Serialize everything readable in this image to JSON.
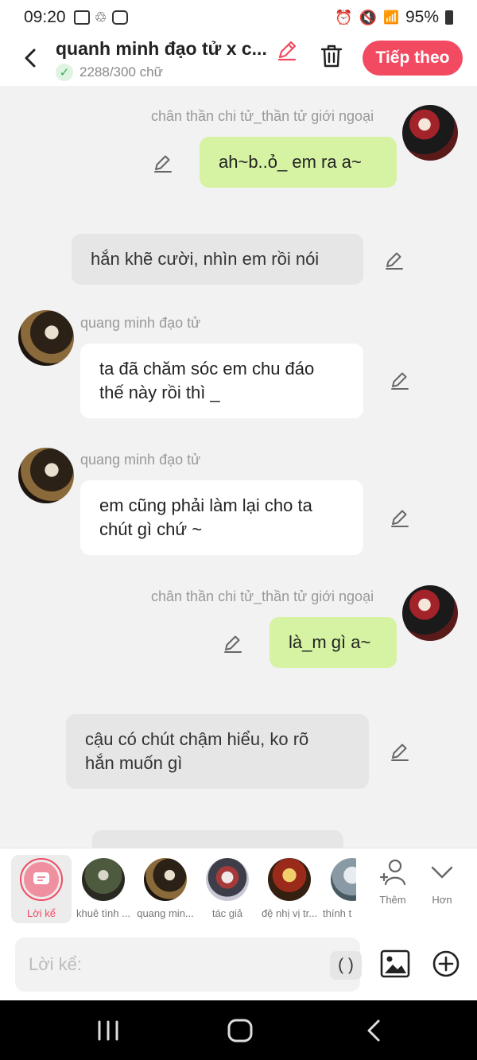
{
  "status": {
    "time": "09:20",
    "battery": "95%"
  },
  "header": {
    "title": "quanh minh đạo tử x c...",
    "word_count": "2288/300 chữ",
    "next_label": "Tiếp theo",
    "accent_color": "#f24a61"
  },
  "messages": [
    {
      "type": "user",
      "name": "chân thần chi tử_thần tử giới ngoại",
      "text": "ah~b..ỏ_ em ra a~"
    },
    {
      "type": "narration",
      "text": "hắn khẽ cười, nhìn em rồi nói"
    },
    {
      "type": "character",
      "name": "quang minh đạo tử",
      "lines": [
        "ta đã chăm sóc em chu đáo",
        "thế này rồi thì _"
      ]
    },
    {
      "type": "character",
      "name": "quang minh đạo tử",
      "lines": [
        "em cũng phải làm lại cho ta",
        "chút gì chứ ~"
      ]
    },
    {
      "type": "user",
      "name": "chân thần chi tử_thần tử giới ngoại",
      "text": "là_m gì a~"
    },
    {
      "type": "narration",
      "lines": [
        "cậu có chút chậm hiểu, ko rõ",
        "hắn muốn gì"
      ]
    }
  ],
  "characters": {
    "narrator": "Lời kể",
    "items": [
      "khuê tình ...",
      "quang min...",
      "tác giả",
      "đệ nhị vị tr...",
      "thính t"
    ],
    "add_label": "Thêm",
    "more_label": "Hơn"
  },
  "input": {
    "placeholder": "Lời kể:",
    "paren_label": "( )"
  }
}
